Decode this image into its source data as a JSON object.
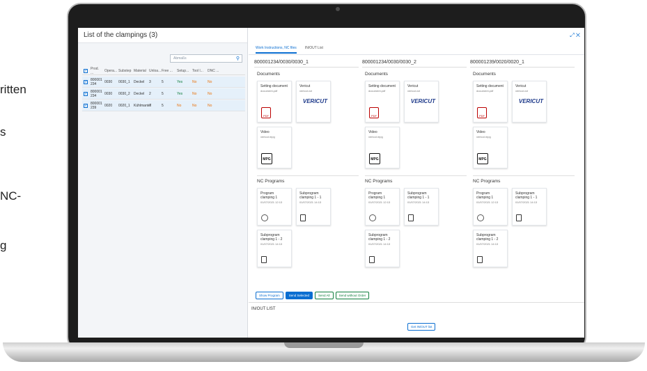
{
  "bg_text": [
    "ritten",
    "s",
    "NC-",
    "g"
  ],
  "left": {
    "title": "List of the clampings (3)",
    "search_placeholder": "Abmaßs",
    "columns": [
      "Prod. ...",
      "Opera...",
      "Substep",
      "Material",
      "Unloa...",
      "Free ...",
      "Setup...",
      "Tool l...",
      "DNC ..."
    ],
    "rows": [
      {
        "prod": "800001 234",
        "op": "0030",
        "substep": "0030_1",
        "material": "Deckel",
        "unload": "3",
        "free": "5",
        "setup": "Yes",
        "tool": "No",
        "dnc": "No"
      },
      {
        "prod": "800001 234",
        "op": "0030",
        "substep": "0030_2",
        "material": "Deckel",
        "unload": "2",
        "free": "5",
        "setup": "Yes",
        "tool": "No",
        "dnc": "No"
      },
      {
        "prod": "800001 239",
        "op": "0020",
        "substep": "0020_1",
        "material": "Kühlmantel",
        "unload": "7",
        "free": "5",
        "setup": "No",
        "tool": "No",
        "dnc": "No"
      }
    ]
  },
  "right": {
    "tabs": [
      "Work Instructions, NC files",
      "IN/OUT List"
    ],
    "columns": [
      {
        "title": "800001234/0030/0030_1",
        "documents_label": "Documents",
        "nc_label": "NC Programs"
      },
      {
        "title": "800001234/0030/0030_2",
        "documents_label": "Documents",
        "nc_label": "NC Programs"
      },
      {
        "title": "800001239/0020/0020_1",
        "documents_label": "Documents",
        "nc_label": "NC Programs"
      }
    ],
    "doc_cards": [
      {
        "name": "Setting document",
        "file": "document.pdf",
        "badge": "PDF"
      },
      {
        "name": "Vericut",
        "file": "vericut.vct",
        "logo": "VERICUT"
      },
      {
        "name": "Video",
        "file": "vericut.mpg",
        "badge": "MPG"
      }
    ],
    "nc_cards": [
      {
        "name": "Program clamping 1",
        "date": "01/07/2021 12:13"
      },
      {
        "name": "Subprogram clamping 1 - 1",
        "date": "01/07/2021 14:13"
      },
      {
        "name": "Subprogram clamping 1 - 2",
        "date": "01/07/2021 14:13"
      }
    ],
    "buttons": [
      "Show Program",
      "Send Selected",
      "Send All",
      "Send without Order"
    ],
    "inout_title": "IN/OUT LIST",
    "get_button": "Get IN/OUT list"
  }
}
